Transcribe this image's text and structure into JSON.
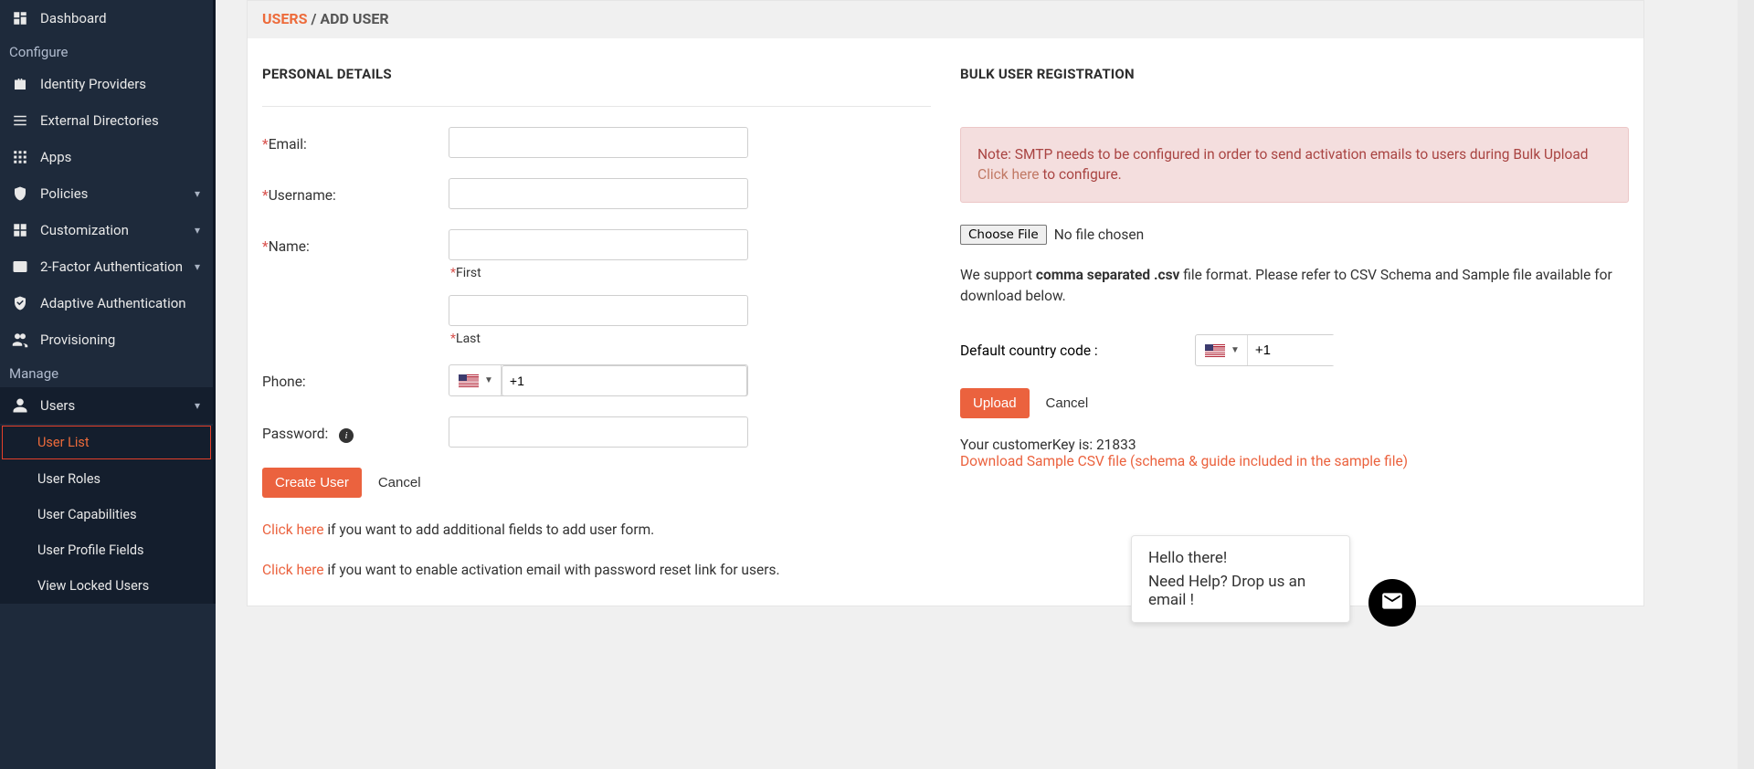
{
  "sidebar": {
    "dashboard": {
      "label": "Dashboard"
    },
    "section_configure": "Configure",
    "identity_providers": "Identity Providers",
    "external_directories": "External Directories",
    "apps": "Apps",
    "policies": "Policies",
    "customization": "Customization",
    "two_factor": "2-Factor Authentication",
    "adaptive_auth": "Adaptive Authentication",
    "provisioning": "Provisioning",
    "section_manage": "Manage",
    "users": "Users",
    "users_sub": {
      "user_list": "User List",
      "user_roles": "User Roles",
      "user_capabilities": "User Capabilities",
      "user_profile_fields": "User Profile Fields",
      "view_locked_users": "View Locked Users"
    }
  },
  "breadcrumb": {
    "root": "USERS",
    "sep": " / ",
    "current": "ADD USER"
  },
  "personal": {
    "title": "PERSONAL DETAILS",
    "email_label": "Email:",
    "username_label": "Username:",
    "name_label": "Name:",
    "first_label": "First",
    "last_label": "Last",
    "phone_label": "Phone:",
    "phone_prefix": "+1",
    "password_label": "Password:",
    "create_btn": "Create User",
    "cancel_btn": "Cancel",
    "helper1_link": "Click here",
    "helper1_rest": " if you want to add additional fields to add user form.",
    "helper2_link": "Click here",
    "helper2_rest": " if you want to enable activation email with password reset link for users."
  },
  "bulk": {
    "title": "BULK USER REGISTRATION",
    "note_pre": "Note: SMTP needs to be configured in order to send activation emails to users during Bulk Upload ",
    "note_link": "Click here",
    "note_post": " to configure.",
    "choose_file": "Choose File",
    "no_file": "No file chosen",
    "support_pre": "We support ",
    "support_bold": "comma separated .csv",
    "support_post": " file format. Please refer to CSV Schema and Sample file available for download below.",
    "dcc_label": "Default country code :",
    "dcc_value": "+1",
    "upload_btn": "Upload",
    "cancel_btn": "Cancel",
    "cust_key": "Your customerKey is: 21833",
    "download_link": "Download Sample CSV file (schema & guide included in the sample file)"
  },
  "chat": {
    "greeting": "Hello there!",
    "prompt": "Need Help? Drop us an email !"
  }
}
